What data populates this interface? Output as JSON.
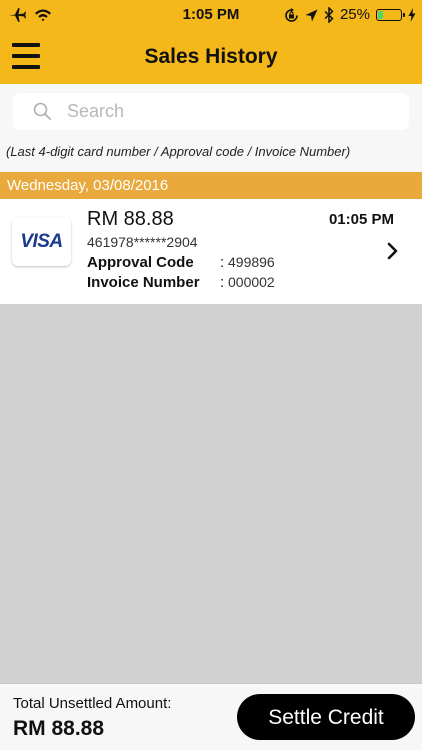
{
  "status_bar": {
    "time": "1:05 PM",
    "battery_percent": "25%",
    "battery_level": 0.25,
    "icons": [
      "airplane-icon",
      "wifi-icon",
      "orientation-lock-icon",
      "location-icon",
      "bluetooth-icon",
      "battery-icon",
      "charging-icon"
    ]
  },
  "navbar": {
    "title": "Sales History",
    "menu_icon": "hamburger-menu-icon"
  },
  "search": {
    "placeholder": "Search",
    "value": "",
    "hint": "(Last 4-digit card number / Approval code / Invoice Number)"
  },
  "sections": [
    {
      "date": "Wednesday, 03/08/2016",
      "transactions": [
        {
          "card_brand": "VISA",
          "amount": "RM 88.88",
          "card_number": "461978******2904",
          "approval_label": "Approval Code",
          "approval_code": "499896",
          "invoice_label": "Invoice Number",
          "invoice_number": "000002",
          "time": "01:05 PM",
          "separator": ":"
        }
      ]
    }
  ],
  "footer": {
    "total_label": "Total Unsettled Amount:",
    "total_value": "RM 88.88",
    "settle_button": "Settle Credit"
  },
  "colors": {
    "brand": "#f5b81b",
    "date_header": "#eaa93c",
    "background": "#d1d1d1",
    "visa_blue": "#1a3a8f",
    "button": "#000000"
  }
}
